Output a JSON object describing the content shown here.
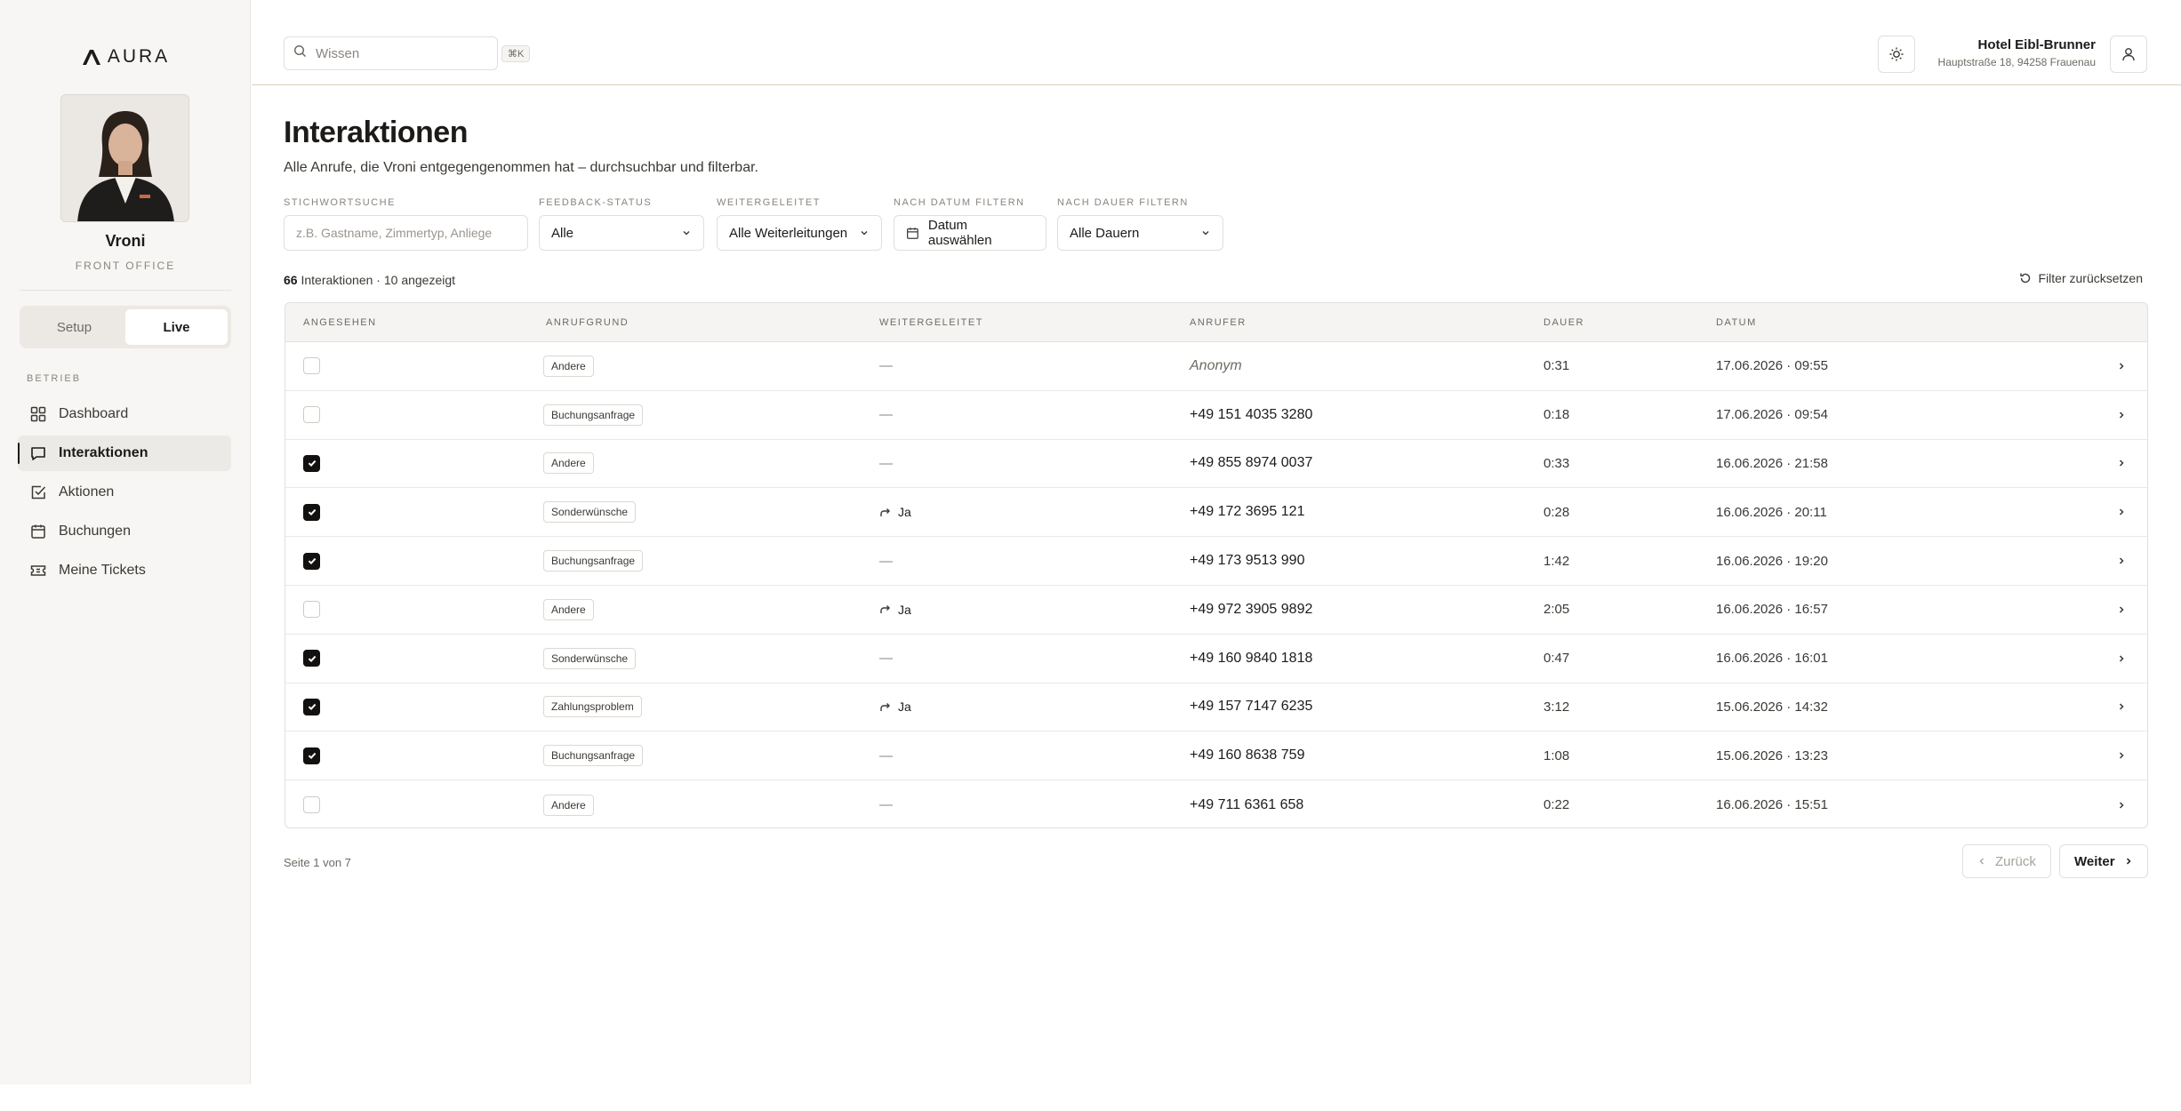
{
  "app": {
    "logo_text": "AURA"
  },
  "agent": {
    "name": "Vroni",
    "role": "FRONT OFFICE"
  },
  "mode": {
    "setup_label": "Setup",
    "live_label": "Live",
    "selected": "Live"
  },
  "sidebar": {
    "section_label": "BETRIEB",
    "items": [
      {
        "label": "Dashboard",
        "icon": "grid-icon"
      },
      {
        "label": "Interaktionen",
        "icon": "chat-icon",
        "active": true
      },
      {
        "label": "Aktionen",
        "icon": "check-square-icon"
      },
      {
        "label": "Buchungen",
        "icon": "calendar-icon"
      },
      {
        "label": "Meine Tickets",
        "icon": "ticket-icon"
      }
    ]
  },
  "topbar": {
    "search_placeholder": "Wissen",
    "search_shortcut": "⌘K",
    "hotel_name": "Hotel Eibl-Brunner",
    "hotel_address": "Hauptstraße 18, 94258 Frauenau"
  },
  "page": {
    "title": "Interaktionen",
    "subtitle": "Alle Anrufe, die Vroni entgegengenommen hat – durchsuchbar und filterbar."
  },
  "filters": {
    "keyword": {
      "label": "STICHWORTSUCHE",
      "placeholder": "z.B. Gastname, Zimmertyp, Anliege",
      "value": ""
    },
    "feedback": {
      "label": "FEEDBACK-STATUS",
      "value": "Alle"
    },
    "forwarded": {
      "label": "WEITERGELEITET",
      "value": "Alle Weiterleitungen"
    },
    "date": {
      "label": "NACH DATUM FILTERN",
      "value": "Datum auswählen"
    },
    "duration": {
      "label": "NACH DAUER FILTERN",
      "value": "Alle Dauern"
    }
  },
  "results": {
    "total": "66",
    "total_suffix": "Interaktionen · 10 angezeigt",
    "reset_label": "Filter zurücksetzen"
  },
  "table": {
    "headers": {
      "seen": "ANGESEHEN",
      "reason": "ANRUFGRUND",
      "forwarded": "WEITERGELEITET",
      "caller": "ANRUFER",
      "duration": "DAUER",
      "date": "DATUM"
    },
    "rows": [
      {
        "seen": false,
        "reason": "Andere",
        "forwarded": "—",
        "caller": "Anonym",
        "duration": "0:31",
        "date": "17.06.2026 · 09:55"
      },
      {
        "seen": false,
        "reason": "Buchungsanfrage",
        "forwarded": "—",
        "caller": "+49 151 4035 3280",
        "duration": "0:18",
        "date": "17.06.2026 · 09:54"
      },
      {
        "seen": true,
        "reason": "Andere",
        "forwarded": "—",
        "caller": "+49 855 8974 0037",
        "duration": "0:33",
        "date": "16.06.2026 · 21:58"
      },
      {
        "seen": true,
        "reason": "Sonderwünsche",
        "forwarded": "Ja",
        "caller": "+49 172 3695 121",
        "duration": "0:28",
        "date": "16.06.2026 · 20:11"
      },
      {
        "seen": true,
        "reason": "Buchungsanfrage",
        "forwarded": "—",
        "caller": "+49 173 9513 990",
        "duration": "1:42",
        "date": "16.06.2026 · 19:20"
      },
      {
        "seen": false,
        "reason": "Andere",
        "forwarded": "Ja",
        "caller": "+49 972 3905 9892",
        "duration": "2:05",
        "date": "16.06.2026 · 16:57"
      },
      {
        "seen": true,
        "reason": "Sonderwünsche",
        "forwarded": "—",
        "caller": "+49 160 9840 1818",
        "duration": "0:47",
        "date": "16.06.2026 · 16:01"
      },
      {
        "seen": true,
        "reason": "Zahlungsproblem",
        "forwarded": "Ja",
        "caller": "+49 157 7147 6235",
        "duration": "3:12",
        "date": "15.06.2026 · 14:32"
      },
      {
        "seen": true,
        "reason": "Buchungsanfrage",
        "forwarded": "—",
        "caller": "+49 160 8638 759",
        "duration": "1:08",
        "date": "15.06.2026 · 13:23"
      },
      {
        "seen": false,
        "reason": "Andere",
        "forwarded": "—",
        "caller": "+49 711 6361 658",
        "duration": "0:22",
        "date": "16.06.2026 · 15:51"
      }
    ]
  },
  "pagination": {
    "info": "Seite 1 von 7",
    "prev_label": "Zurück",
    "next_label": "Weiter"
  }
}
